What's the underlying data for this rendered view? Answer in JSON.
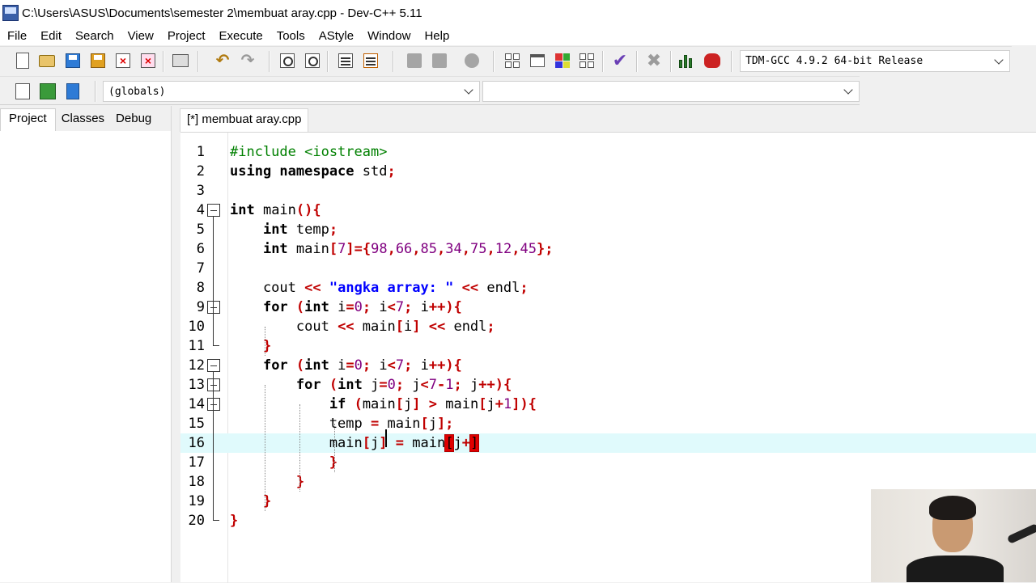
{
  "window": {
    "title": "C:\\Users\\ASUS\\Documents\\semester 2\\membuat aray.cpp - Dev-C++ 5.11"
  },
  "menu": [
    "File",
    "Edit",
    "Search",
    "View",
    "Project",
    "Execute",
    "Tools",
    "AStyle",
    "Window",
    "Help"
  ],
  "toolbar": {
    "compiler": "TDM-GCC 4.9.2 64-bit Release",
    "globals": "(globals)",
    "second_select": ""
  },
  "left_panel": {
    "tabs": [
      "Project",
      "Classes",
      "Debug"
    ]
  },
  "editor": {
    "tab": "[*] membuat aray.cpp",
    "current_line": 16,
    "line_numbers": [
      "1",
      "2",
      "3",
      "4",
      "5",
      "6",
      "7",
      "8",
      "9",
      "10",
      "11",
      "12",
      "13",
      "14",
      "15",
      "16",
      "17",
      "18",
      "19",
      "20"
    ]
  },
  "colors": {
    "keyword": "#000000",
    "preprocessor": "#008000",
    "symbol": "#c00000",
    "number": "#800080",
    "string": "#0000ff",
    "current_line": "#e0fafc",
    "bracket_highlight": "#e00000"
  },
  "icons": [
    "new-file-icon",
    "open-icon",
    "save-icon",
    "save-all-icon",
    "close-icon",
    "close-all-icon",
    "print-icon",
    "undo-icon",
    "redo-icon",
    "find-icon",
    "replace-icon",
    "indent-icon",
    "unindent-icon",
    "compile-icon",
    "run-icon",
    "compile-run-icon",
    "rebuild-icon",
    "new-project-icon",
    "new-class-icon",
    "insert-icon",
    "toggle-icon",
    "check-icon",
    "stop-icon",
    "chart-icon",
    "debug-icon"
  ]
}
